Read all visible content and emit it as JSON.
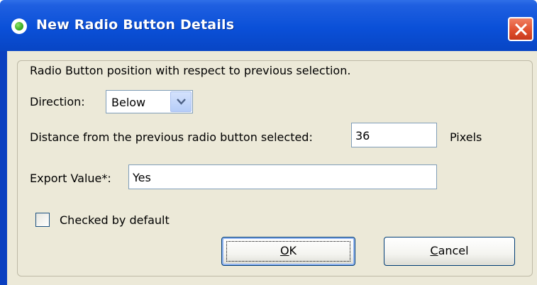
{
  "window": {
    "title": "New Radio Button Details"
  },
  "form": {
    "intro_text": "Radio Button position with respect to previous selection.",
    "direction_label": "Direction:",
    "direction_value": "Below",
    "distance_label": "Distance from the previous radio button selected:",
    "distance_value": "36",
    "distance_unit": "Pixels",
    "export_label": "Export Value*:",
    "export_value": "Yes",
    "checkbox_label": "Checked by default",
    "checkbox_checked": false
  },
  "buttons": {
    "ok_mnemonic": "O",
    "ok_rest": "K",
    "cancel_mnemonic": "C",
    "cancel_rest": "ancel"
  },
  "icons": {
    "title_icon": "radio-button-icon",
    "close_icon": "close-icon",
    "dropdown_icon": "chevron-down-icon"
  },
  "colors": {
    "titlebar": "#0a50d8",
    "close_button": "#e0502f",
    "dialog_background": "#ece9d8"
  }
}
